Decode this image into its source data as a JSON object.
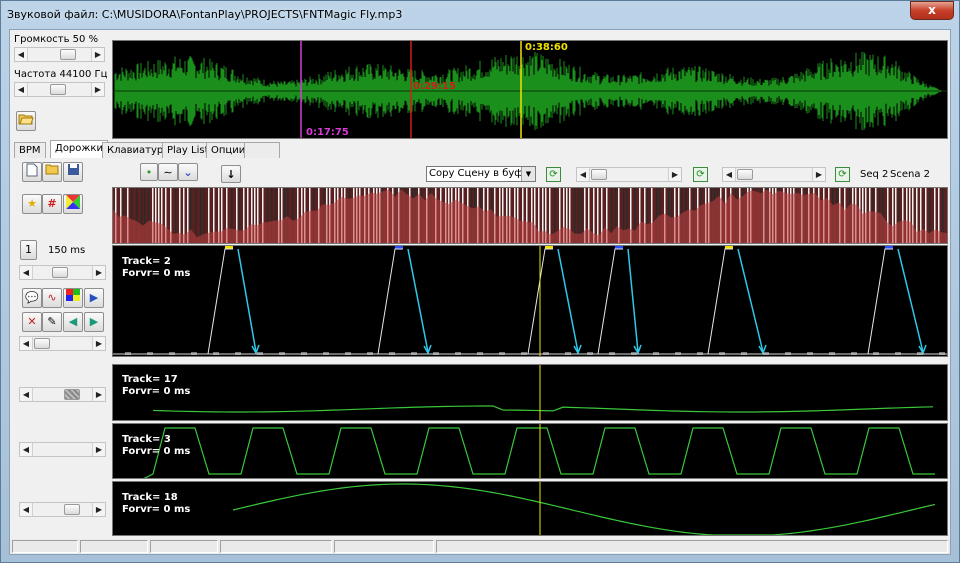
{
  "window": {
    "title": "Звуковой файл: C:\\MUSIDORA\\FontanPlay\\PROJECTS\\FNTMagic Fly.mp3",
    "close_glyph": "x"
  },
  "controls": {
    "volume_label": "Громкость 50 %",
    "volume_value": 0.5,
    "frequency_label": "Частота 44100 Гц",
    "tempo_value": "150 ms",
    "tempo_icon_text": "1"
  },
  "waveform": {
    "time_yellow": "0:38:60",
    "time_red": "0:29:15",
    "time_magenta": "0:17:75",
    "colors": {
      "wave": "#1b8f1b",
      "yellow": "#f2e200",
      "red": "#d11c1c",
      "magenta": "#d63bd6"
    }
  },
  "tabs": [
    {
      "label": "BPM",
      "active": false
    },
    {
      "label": "Дорожки",
      "active": true
    },
    {
      "label": "Клавиатура",
      "active": false
    },
    {
      "label": "Play List",
      "active": false
    },
    {
      "label": "Опции",
      "active": false
    }
  ],
  "toolbar": {
    "copy_scene_combo": "Copy Сцену в буфер",
    "seq_label": "Seq 2",
    "scene_label": "Scena 2"
  },
  "icons": {
    "new": "new-file-icon",
    "open": "open-folder-icon",
    "save": "save-icon",
    "star": "star-icon",
    "grid": "pattern-icon",
    "color": "color-palette-icon",
    "comment": "comment-icon",
    "wave": "wave-icon",
    "rgb": "rgb-icon",
    "play": "play-icon",
    "delete": "delete-icon",
    "pick": "eyedropper-icon",
    "left": "arrow-left-icon",
    "right": "arrow-right-icon"
  },
  "tracks": [
    {
      "name": "Track= 2",
      "offset": "Forvr= 0 ms"
    },
    {
      "name": "Track= 17",
      "offset": "Forvr= 0 ms"
    },
    {
      "name": "Track= 3",
      "offset": "Forvr= 0 ms"
    },
    {
      "name": "Track= 18",
      "offset": "Forvr= 0 ms"
    }
  ]
}
